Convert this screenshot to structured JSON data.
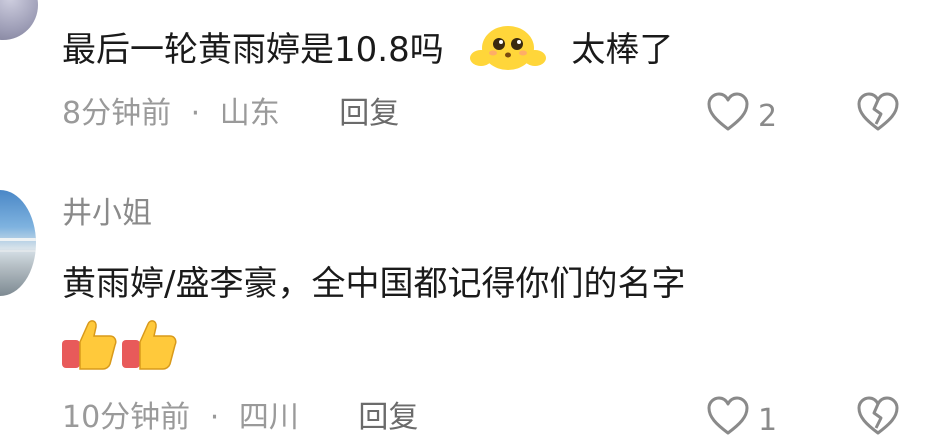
{
  "comments": [
    {
      "text_before": "最后一轮黄雨婷是10.8吗",
      "emoji": "cute-face-emoji",
      "text_after": "太棒了",
      "time": "8分钟前",
      "separator": "·",
      "location": "山东",
      "reply_label": "回复",
      "likes": "2"
    },
    {
      "username": "井小姐",
      "text": "黄雨婷/盛李豪，全中国都记得你们的名字",
      "emojis": [
        "thumbs-up-emoji",
        "thumbs-up-emoji"
      ],
      "time": "10分钟前",
      "separator": "·",
      "location": "四川",
      "reply_label": "回复",
      "likes": "1"
    }
  ],
  "colors": {
    "meta": "#9a9a9a",
    "text": "#1a1a1a",
    "icon": "#8a8a8a"
  }
}
